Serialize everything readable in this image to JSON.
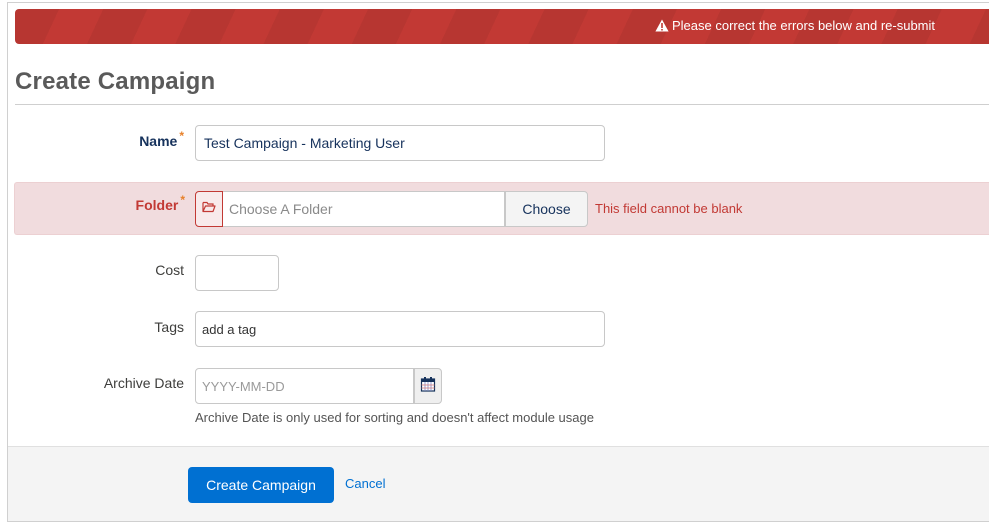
{
  "banner": {
    "icon": "warning-icon",
    "message": "Please correct the errors below and re-submit",
    "color": "#c23934"
  },
  "page": {
    "title": "Create Campaign"
  },
  "form": {
    "name": {
      "label": "Name",
      "required_mark": "*",
      "value": "Test Campaign - Marketing User"
    },
    "folder": {
      "label": "Folder",
      "required_mark": "*",
      "icon": "folder-open-icon",
      "placeholder": "Choose A Folder",
      "choose_label": "Choose",
      "error": "This field cannot be blank"
    },
    "cost": {
      "label": "Cost",
      "value": ""
    },
    "tags": {
      "label": "Tags",
      "value": "add a tag"
    },
    "archive_date": {
      "label": "Archive Date",
      "placeholder": "YYYY-MM-DD",
      "icon": "calendar-icon",
      "help": "Archive Date is only used for sorting and doesn't affect module usage"
    }
  },
  "footer": {
    "submit_label": "Create Campaign",
    "cancel_label": "Cancel",
    "primary_color": "#0070d2"
  }
}
